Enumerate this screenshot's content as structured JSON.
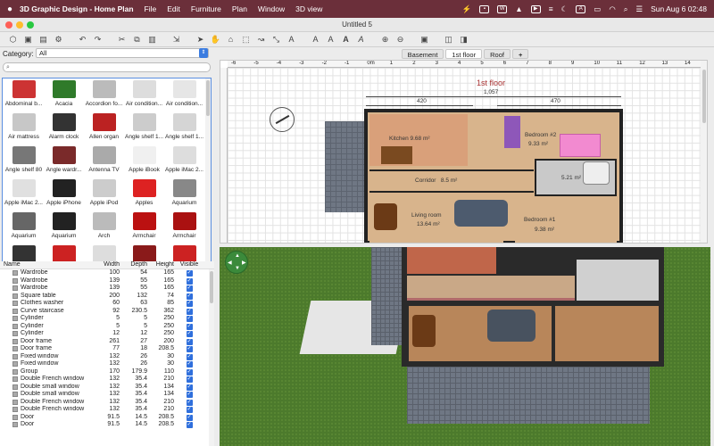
{
  "menubar": {
    "app_name": "3D Graphic Design - Home Plan",
    "items": [
      "File",
      "Edit",
      "Furniture",
      "Plan",
      "Window",
      "3D view"
    ],
    "clock": "Sun Aug 6  02:48"
  },
  "window": {
    "title": "Untitled 5"
  },
  "catalog": {
    "category_label": "Category:",
    "category_value": "All",
    "items": [
      {
        "label": "Abdominal b...",
        "color": "#c33"
      },
      {
        "label": "Acacia",
        "color": "#2f7a2a"
      },
      {
        "label": "Accordion fo...",
        "color": "#bbb"
      },
      {
        "label": "Air condition...",
        "color": "#ddd"
      },
      {
        "label": "Air condition...",
        "color": "#e6e6e6"
      },
      {
        "label": "Air mattress",
        "color": "#c7c7c7"
      },
      {
        "label": "Alarm clock",
        "color": "#333"
      },
      {
        "label": "Allen organ",
        "color": "#b22"
      },
      {
        "label": "Angle shelf 1...",
        "color": "#ccc"
      },
      {
        "label": "Angle shelf 1...",
        "color": "#d5d5d5"
      },
      {
        "label": "Angle shelf 80",
        "color": "#777"
      },
      {
        "label": "Angle wardr...",
        "color": "#7a2a2a"
      },
      {
        "label": "Antenna TV",
        "color": "#aaa"
      },
      {
        "label": "Apple iBook",
        "color": "#f0f0f0"
      },
      {
        "label": "Apple iMac 2...",
        "color": "#ddd"
      },
      {
        "label": "Apple iMac 2...",
        "color": "#e0e0e0"
      },
      {
        "label": "Apple iPhone",
        "color": "#222"
      },
      {
        "label": "Apple iPod",
        "color": "#ccc"
      },
      {
        "label": "Apples",
        "color": "#d22"
      },
      {
        "label": "Aquarium",
        "color": "#888"
      },
      {
        "label": "Aquarium",
        "color": "#666"
      },
      {
        "label": "Aquarium",
        "color": "#222"
      },
      {
        "label": "Arch",
        "color": "#bbb"
      },
      {
        "label": "Armchair",
        "color": "#b11"
      },
      {
        "label": "Armchair",
        "color": "#a11"
      },
      {
        "label": "",
        "color": "#333"
      },
      {
        "label": "",
        "color": "#c22"
      },
      {
        "label": "",
        "color": "#ddd"
      },
      {
        "label": "",
        "color": "#8a1a1a"
      },
      {
        "label": "",
        "color": "#c22"
      }
    ]
  },
  "furniture_table": {
    "headers": {
      "name": "Name",
      "width": "Width",
      "depth": "Depth",
      "height": "Height",
      "visible": "Visible"
    },
    "rows": [
      {
        "name": "Wardrobe",
        "w": "100",
        "d": "54",
        "h": "165"
      },
      {
        "name": "Wardrobe",
        "w": "139",
        "d": "55",
        "h": "165"
      },
      {
        "name": "Wardrobe",
        "w": "139",
        "d": "55",
        "h": "165"
      },
      {
        "name": "Square table",
        "w": "200",
        "d": "132",
        "h": "74"
      },
      {
        "name": "Clothes washer",
        "w": "60",
        "d": "63",
        "h": "85"
      },
      {
        "name": "Curve staircase",
        "w": "92",
        "d": "230.5",
        "h": "362"
      },
      {
        "name": "Cylinder",
        "w": "5",
        "d": "5",
        "h": "250"
      },
      {
        "name": "Cylinder",
        "w": "5",
        "d": "5",
        "h": "250"
      },
      {
        "name": "Cylinder",
        "w": "12",
        "d": "12",
        "h": "250"
      },
      {
        "name": "Door frame",
        "w": "261",
        "d": "27",
        "h": "200"
      },
      {
        "name": "Door frame",
        "w": "77",
        "d": "18",
        "h": "208.5"
      },
      {
        "name": "Fixed window",
        "w": "132",
        "d": "26",
        "h": "30"
      },
      {
        "name": "Fixed window",
        "w": "132",
        "d": "26",
        "h": "30"
      },
      {
        "name": "Group",
        "w": "170",
        "d": "179.9",
        "h": "110"
      },
      {
        "name": "Double French window",
        "w": "132",
        "d": "35.4",
        "h": "210"
      },
      {
        "name": "Double small window",
        "w": "132",
        "d": "35.4",
        "h": "134"
      },
      {
        "name": "Double small window",
        "w": "132",
        "d": "35.4",
        "h": "134"
      },
      {
        "name": "Double French window",
        "w": "132",
        "d": "35.4",
        "h": "210"
      },
      {
        "name": "Double French window",
        "w": "132",
        "d": "35.4",
        "h": "210"
      },
      {
        "name": "Door",
        "w": "91.5",
        "d": "14.5",
        "h": "208.5"
      },
      {
        "name": "Door",
        "w": "91.5",
        "d": "14.5",
        "h": "208.5"
      }
    ]
  },
  "tabs": [
    "Basement",
    "1st floor",
    "Roof",
    "+"
  ],
  "plan": {
    "floor_title": "1st floor",
    "ruler_marks": [
      "-6",
      "-5",
      "-4",
      "-3",
      "-2",
      "-1",
      "0m",
      "1",
      "2",
      "3",
      "4",
      "5",
      "6",
      "7",
      "8",
      "9",
      "10",
      "11",
      "12",
      "13",
      "14",
      "15",
      "16"
    ],
    "dims": {
      "total": "1,057",
      "left": "420",
      "right": "470"
    },
    "rooms": [
      {
        "name": "Kitchen",
        "area": "9.68 m²"
      },
      {
        "name": "Bedroom #2",
        "area": "9.33 m²"
      },
      {
        "name": "Corridor",
        "area": "8.5 m²"
      },
      {
        "name": "",
        "area": "5.21 m²"
      },
      {
        "name": "Living room",
        "area": "13.64 m²"
      },
      {
        "name": "Bedroom #1",
        "area": "9.38 m²"
      }
    ]
  },
  "colors": {
    "menubar": "#6b2f3a",
    "accent": "#2f6fdc",
    "grass": "#4c7a2c",
    "wall": "#222222",
    "floor": "#d8b48c"
  }
}
